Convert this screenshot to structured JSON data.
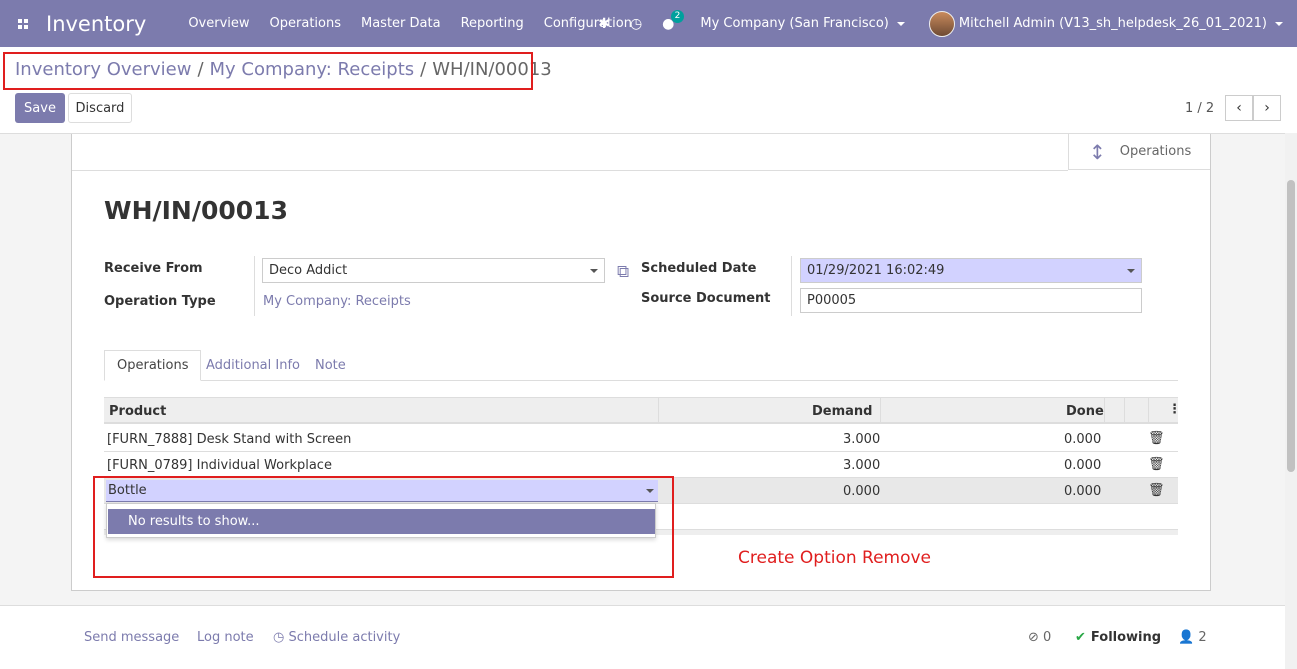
{
  "navbar": {
    "brand": "Inventory",
    "menu": [
      "Overview",
      "Operations",
      "Master Data",
      "Reporting",
      "Configuration"
    ],
    "messages_badge": "2",
    "company": "My Company (San Francisco)",
    "user": "Mitchell Admin (V13_sh_helpdesk_26_01_2021)",
    "accent_color": "#7c7bad"
  },
  "breadcrumb": {
    "items": [
      "Inventory Overview",
      "My Company: Receipts"
    ],
    "active": "WH/IN/00013",
    "separator": "/"
  },
  "actions": {
    "save_label": "Save",
    "discard_label": "Discard"
  },
  "pager": {
    "value": "1 / 2",
    "prev": "‹",
    "next": "›"
  },
  "smart_button": {
    "label": "Operations",
    "icon": "arrows-v-icon"
  },
  "form": {
    "title": "WH/IN/00013",
    "receive_from_label": "Receive From",
    "receive_from_value": "Deco Addict",
    "operation_type_label": "Operation Type",
    "operation_type_value": "My Company: Receipts",
    "scheduled_date_label": "Scheduled Date",
    "scheduled_date_value": "01/29/2021 16:02:49",
    "source_document_label": "Source Document",
    "source_document_value": "P00005"
  },
  "tabs": [
    "Operations",
    "Additional Info",
    "Note"
  ],
  "table": {
    "headers": {
      "product": "Product",
      "demand": "Demand",
      "done": "Done"
    },
    "rows": [
      {
        "product": "[FURN_7888] Desk Stand with Screen",
        "demand": "3.000",
        "done": "0.000"
      },
      {
        "product": "[FURN_0789] Individual Workplace",
        "demand": "3.000",
        "done": "0.000"
      }
    ],
    "editing_row": {
      "product": "Bottle",
      "demand": "0.000",
      "done": "0.000"
    },
    "dropdown_text": "No results to show..."
  },
  "annotation": "Create Option Remove",
  "chatter": {
    "send_message": "Send message",
    "log_note": "Log note",
    "schedule_activity": "Schedule activity",
    "attachments": "0",
    "following": "Following",
    "followers": "2"
  }
}
